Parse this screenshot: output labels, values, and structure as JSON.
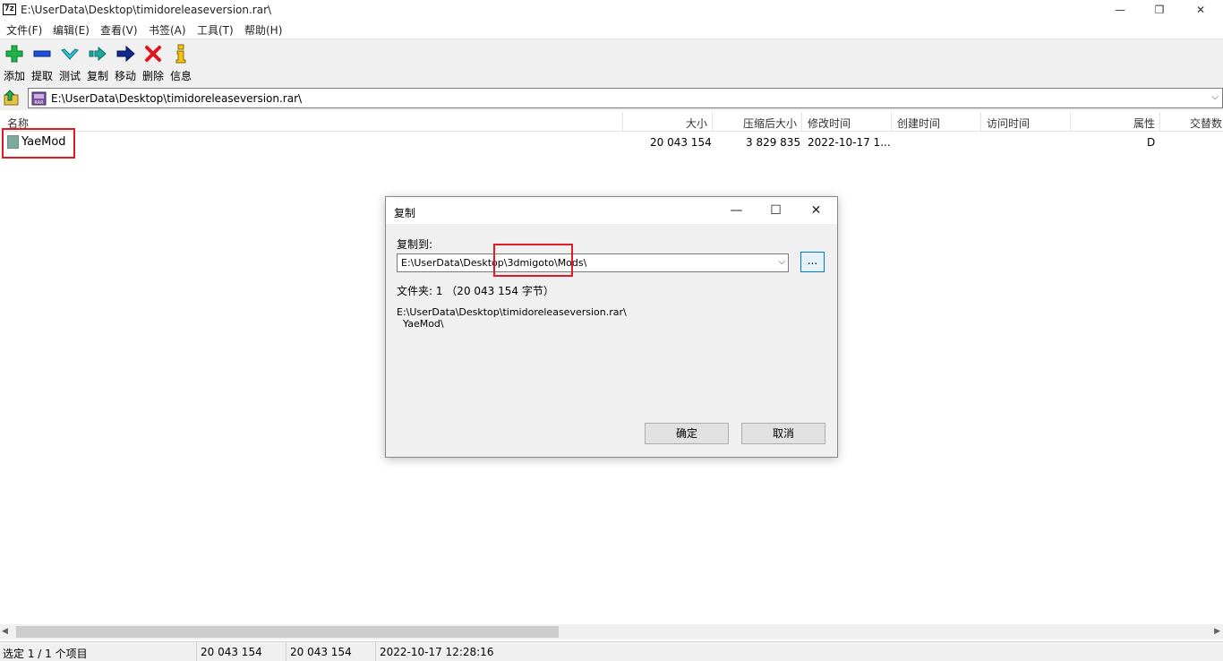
{
  "window": {
    "app_icon_text": "7z",
    "title": "E:\\UserData\\Desktop\\timidoreleaseversion.rar\\",
    "minimize": "—",
    "restore": "❐",
    "close": "✕"
  },
  "menu": [
    {
      "label": "文件(F)"
    },
    {
      "label": "编辑(E)"
    },
    {
      "label": "查看(V)"
    },
    {
      "label": "书签(A)"
    },
    {
      "label": "工具(T)"
    },
    {
      "label": "帮助(H)"
    }
  ],
  "toolbar": [
    {
      "label": "添加",
      "icon": "add-icon"
    },
    {
      "label": "提取",
      "icon": "extract-icon"
    },
    {
      "label": "测试",
      "icon": "test-icon"
    },
    {
      "label": "复制",
      "icon": "copy-icon"
    },
    {
      "label": "移动",
      "icon": "move-icon"
    },
    {
      "label": "删除",
      "icon": "delete-icon"
    },
    {
      "label": "信息",
      "icon": "info-icon"
    }
  ],
  "address": {
    "path": "E:\\UserData\\Desktop\\timidoreleaseversion.rar\\",
    "dropdown": "⌵"
  },
  "columns": [
    {
      "label": "名称"
    },
    {
      "label": "大小"
    },
    {
      "label": "压缩后大小"
    },
    {
      "label": "修改时间"
    },
    {
      "label": "创建时间"
    },
    {
      "label": "访问时间"
    },
    {
      "label": "属性"
    },
    {
      "label": "交替数"
    }
  ],
  "rows": [
    {
      "name": "YaeMod",
      "size": "20 043 154",
      "packed": "3 829 835",
      "modified": "2022-10-17 1...",
      "attributes": "D"
    }
  ],
  "statusbar": {
    "selection": "选定 1 / 1 个项目",
    "size": "20 043 154",
    "packed": "20 043 154",
    "modified": "2022-10-17 12:28:16"
  },
  "dialog": {
    "title": "复制",
    "minimize": "—",
    "maximize": "☐",
    "close": "✕",
    "copy_to_label": "复制到:",
    "destination": "E:\\UserData\\Desktop\\3dmigoto\\Mods\\",
    "browse": "...",
    "summary": "文件夹: 1  （20 043 154 字节）",
    "source_path": "E:\\UserData\\Desktop\\timidoreleaseversion.rar\\\n  YaeMod\\",
    "ok": "确定",
    "cancel": "取消"
  },
  "colors": {
    "highlight": "#e01b24",
    "accent": "#0078d7"
  }
}
